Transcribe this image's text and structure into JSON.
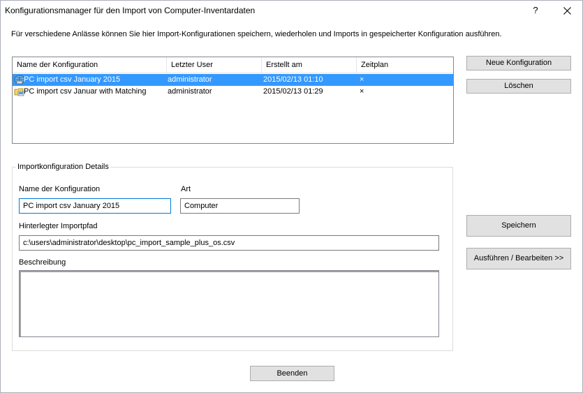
{
  "window": {
    "title": "Konfigurationsmanager für den Import von Computer-Inventardaten",
    "help_label": "?"
  },
  "intro_text": "Für verschiedene Anlässe können Sie hier Import-Konfigurationen speichern, wiederholen und Imports in gespeicherter Konfiguration ausführen.",
  "list": {
    "columns": [
      "Name der Konfiguration",
      "Letzter User",
      "Erstellt am",
      "Zeitplan"
    ],
    "rows": [
      {
        "name": "PC import csv January 2015",
        "user": "administrator",
        "created": "2015/02/13 01:10",
        "schedule": "×",
        "icon": "network-pc-icon",
        "selected": true
      },
      {
        "name": "PC import csv Januar with Matching",
        "user": "administrator",
        "created": "2015/02/13 01:29",
        "schedule": "×",
        "icon": "folder-pc-icon",
        "selected": false
      }
    ]
  },
  "buttons": {
    "new_config": "Neue Konfiguration",
    "delete": "Löschen",
    "save": "Speichern",
    "execute_edit": "Ausführen / Bearbeiten >>",
    "exit": "Beenden"
  },
  "details": {
    "group_title": "Importkonfiguration Details",
    "name_label": "Name der Konfiguration",
    "name_value": "PC import csv January 2015",
    "type_label": "Art",
    "type_value": "Computer",
    "path_label": "Hinterlegter Importpfad",
    "path_value": "c:\\users\\administrator\\desktop\\pc_import_sample_plus_os.csv",
    "description_label": "Beschreibung",
    "description_value": ""
  },
  "colors": {
    "selection": "#3399ff",
    "focus_border": "#0078d7",
    "button_bg": "#e1e1e1"
  }
}
